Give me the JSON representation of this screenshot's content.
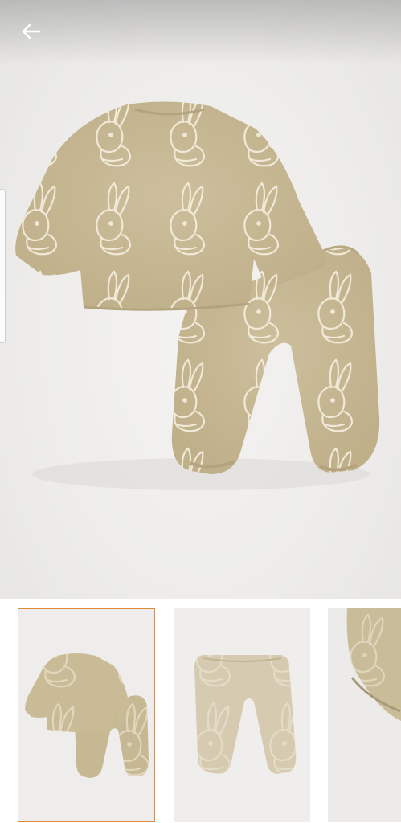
{
  "product": {
    "hero_image": "baby-bunny-print-sweatshirt-and-pants-set",
    "thumbnails": [
      {
        "image": "set-top-and-pants",
        "selected": true
      },
      {
        "image": "pants-only",
        "selected": false
      },
      {
        "image": "fabric-detail",
        "selected": false
      }
    ]
  },
  "icons": {
    "back": "arrow-left-icon"
  },
  "colors": {
    "fabric": "#cbbd98",
    "print": "#f1eadb",
    "selected_border": "#e08a3c"
  }
}
